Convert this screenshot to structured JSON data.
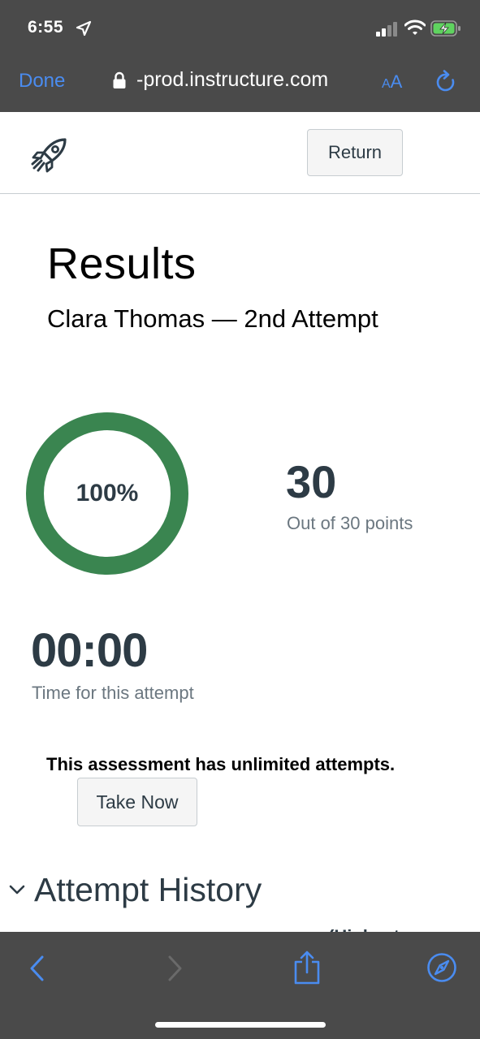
{
  "status_bar": {
    "time": "6:55",
    "icons": [
      "location-arrow-icon",
      "signal-icon",
      "wifi-icon",
      "battery-charging-icon"
    ]
  },
  "browser": {
    "done_label": "Done",
    "url": "-prod.instructure.com",
    "reader_small": "A",
    "reader_large": "A",
    "icons": [
      "lock-icon",
      "reload-icon",
      "back-icon",
      "forward-icon",
      "share-icon",
      "compass-icon"
    ]
  },
  "header": {
    "return_label": "Return",
    "logo_icon": "rocket-icon"
  },
  "results": {
    "title": "Results",
    "subtitle": "Clara Thomas — 2nd Attempt",
    "score_percent_text": "100%",
    "score_fraction": 1.0,
    "points": "30",
    "points_caption": "Out of 30 points",
    "time_value": "00:00",
    "time_caption": "Time for this attempt",
    "attempts_note": "This assessment has unlimited attempts.",
    "take_now_label": "Take Now"
  },
  "history": {
    "title": "Attempt History",
    "clipped_header": "(Highest"
  },
  "colors": {
    "chrome_bg": "#4a4a4a",
    "ios_blue": "#4a8cf0",
    "score_ring": "#3a8550",
    "text_dark": "#2d3b45",
    "text_muted": "#6b7780",
    "button_bg": "#f5f5f5",
    "border": "#c7cdd1"
  }
}
